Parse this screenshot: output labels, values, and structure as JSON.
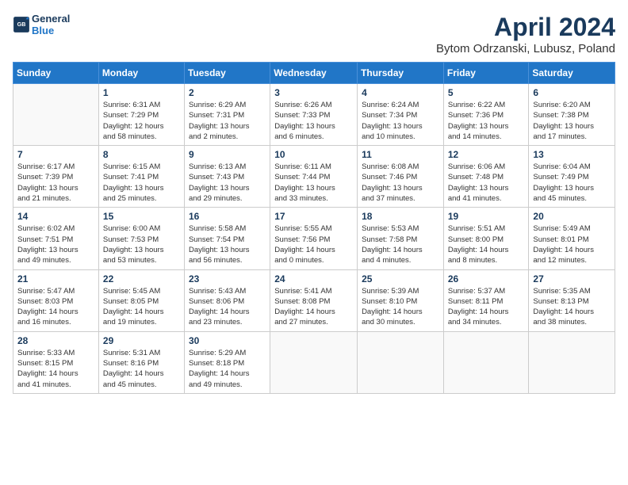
{
  "header": {
    "logo_general": "General",
    "logo_blue": "Blue",
    "title": "April 2024",
    "subtitle": "Bytom Odrzanski, Lubusz, Poland"
  },
  "days_of_week": [
    "Sunday",
    "Monday",
    "Tuesday",
    "Wednesday",
    "Thursday",
    "Friday",
    "Saturday"
  ],
  "weeks": [
    [
      {
        "day": "",
        "info": ""
      },
      {
        "day": "1",
        "info": "Sunrise: 6:31 AM\nSunset: 7:29 PM\nDaylight: 12 hours\nand 58 minutes."
      },
      {
        "day": "2",
        "info": "Sunrise: 6:29 AM\nSunset: 7:31 PM\nDaylight: 13 hours\nand 2 minutes."
      },
      {
        "day": "3",
        "info": "Sunrise: 6:26 AM\nSunset: 7:33 PM\nDaylight: 13 hours\nand 6 minutes."
      },
      {
        "day": "4",
        "info": "Sunrise: 6:24 AM\nSunset: 7:34 PM\nDaylight: 13 hours\nand 10 minutes."
      },
      {
        "day": "5",
        "info": "Sunrise: 6:22 AM\nSunset: 7:36 PM\nDaylight: 13 hours\nand 14 minutes."
      },
      {
        "day": "6",
        "info": "Sunrise: 6:20 AM\nSunset: 7:38 PM\nDaylight: 13 hours\nand 17 minutes."
      }
    ],
    [
      {
        "day": "7",
        "info": "Sunrise: 6:17 AM\nSunset: 7:39 PM\nDaylight: 13 hours\nand 21 minutes."
      },
      {
        "day": "8",
        "info": "Sunrise: 6:15 AM\nSunset: 7:41 PM\nDaylight: 13 hours\nand 25 minutes."
      },
      {
        "day": "9",
        "info": "Sunrise: 6:13 AM\nSunset: 7:43 PM\nDaylight: 13 hours\nand 29 minutes."
      },
      {
        "day": "10",
        "info": "Sunrise: 6:11 AM\nSunset: 7:44 PM\nDaylight: 13 hours\nand 33 minutes."
      },
      {
        "day": "11",
        "info": "Sunrise: 6:08 AM\nSunset: 7:46 PM\nDaylight: 13 hours\nand 37 minutes."
      },
      {
        "day": "12",
        "info": "Sunrise: 6:06 AM\nSunset: 7:48 PM\nDaylight: 13 hours\nand 41 minutes."
      },
      {
        "day": "13",
        "info": "Sunrise: 6:04 AM\nSunset: 7:49 PM\nDaylight: 13 hours\nand 45 minutes."
      }
    ],
    [
      {
        "day": "14",
        "info": "Sunrise: 6:02 AM\nSunset: 7:51 PM\nDaylight: 13 hours\nand 49 minutes."
      },
      {
        "day": "15",
        "info": "Sunrise: 6:00 AM\nSunset: 7:53 PM\nDaylight: 13 hours\nand 53 minutes."
      },
      {
        "day": "16",
        "info": "Sunrise: 5:58 AM\nSunset: 7:54 PM\nDaylight: 13 hours\nand 56 minutes."
      },
      {
        "day": "17",
        "info": "Sunrise: 5:55 AM\nSunset: 7:56 PM\nDaylight: 14 hours\nand 0 minutes."
      },
      {
        "day": "18",
        "info": "Sunrise: 5:53 AM\nSunset: 7:58 PM\nDaylight: 14 hours\nand 4 minutes."
      },
      {
        "day": "19",
        "info": "Sunrise: 5:51 AM\nSunset: 8:00 PM\nDaylight: 14 hours\nand 8 minutes."
      },
      {
        "day": "20",
        "info": "Sunrise: 5:49 AM\nSunset: 8:01 PM\nDaylight: 14 hours\nand 12 minutes."
      }
    ],
    [
      {
        "day": "21",
        "info": "Sunrise: 5:47 AM\nSunset: 8:03 PM\nDaylight: 14 hours\nand 16 minutes."
      },
      {
        "day": "22",
        "info": "Sunrise: 5:45 AM\nSunset: 8:05 PM\nDaylight: 14 hours\nand 19 minutes."
      },
      {
        "day": "23",
        "info": "Sunrise: 5:43 AM\nSunset: 8:06 PM\nDaylight: 14 hours\nand 23 minutes."
      },
      {
        "day": "24",
        "info": "Sunrise: 5:41 AM\nSunset: 8:08 PM\nDaylight: 14 hours\nand 27 minutes."
      },
      {
        "day": "25",
        "info": "Sunrise: 5:39 AM\nSunset: 8:10 PM\nDaylight: 14 hours\nand 30 minutes."
      },
      {
        "day": "26",
        "info": "Sunrise: 5:37 AM\nSunset: 8:11 PM\nDaylight: 14 hours\nand 34 minutes."
      },
      {
        "day": "27",
        "info": "Sunrise: 5:35 AM\nSunset: 8:13 PM\nDaylight: 14 hours\nand 38 minutes."
      }
    ],
    [
      {
        "day": "28",
        "info": "Sunrise: 5:33 AM\nSunset: 8:15 PM\nDaylight: 14 hours\nand 41 minutes."
      },
      {
        "day": "29",
        "info": "Sunrise: 5:31 AM\nSunset: 8:16 PM\nDaylight: 14 hours\nand 45 minutes."
      },
      {
        "day": "30",
        "info": "Sunrise: 5:29 AM\nSunset: 8:18 PM\nDaylight: 14 hours\nand 49 minutes."
      },
      {
        "day": "",
        "info": ""
      },
      {
        "day": "",
        "info": ""
      },
      {
        "day": "",
        "info": ""
      },
      {
        "day": "",
        "info": ""
      }
    ]
  ]
}
